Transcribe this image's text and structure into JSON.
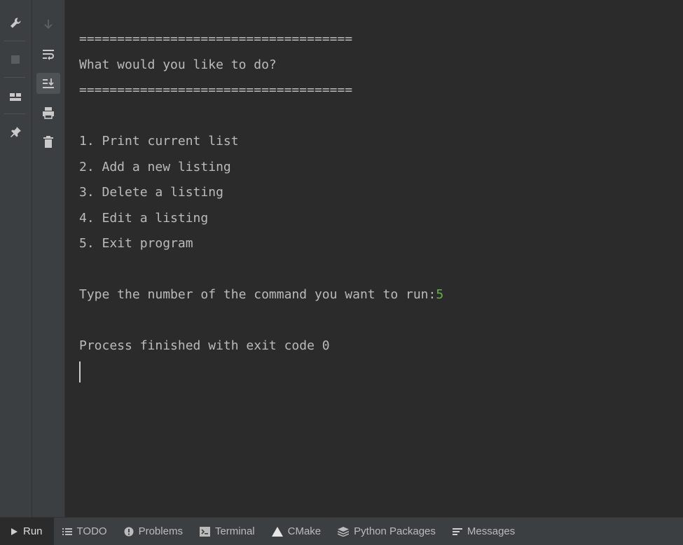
{
  "window": {
    "title": "Run"
  },
  "console": {
    "lines": [
      "====================================",
      "What would you like to do?",
      "====================================",
      "",
      "1. Print current list",
      "2. Add a new listing",
      "3. Delete a listing",
      "4. Edit a listing",
      "5. Exit program",
      "",
      "Type the number of the command you want to run:",
      "",
      "Process finished with exit code 0"
    ],
    "user_input": "5"
  },
  "left_toolbar": {
    "icons": [
      "wrench-icon",
      "stop-icon",
      "layout-icon",
      "pin-icon"
    ]
  },
  "console_toolbar": {
    "icons": [
      "scroll-down-icon",
      "soft-wrap-icon",
      "scroll-to-end-icon",
      "print-icon",
      "trash-icon"
    ],
    "active": "scroll-to-end-icon"
  },
  "bottom_tabs": [
    {
      "label": "Run",
      "icon": "play-icon",
      "active": true
    },
    {
      "label": "TODO",
      "icon": "list-icon",
      "active": false
    },
    {
      "label": "Problems",
      "icon": "alert-icon",
      "active": false
    },
    {
      "label": "Terminal",
      "icon": "terminal-icon",
      "active": false
    },
    {
      "label": "CMake",
      "icon": "cmake-icon",
      "active": false
    },
    {
      "label": "Python Packages",
      "icon": "packages-icon",
      "active": false
    },
    {
      "label": "Messages",
      "icon": "messages-icon",
      "active": false
    }
  ],
  "colors": {
    "background": "#2b2b2b",
    "toolbar": "#3c3f41",
    "text": "#bbbbbb",
    "user_input": "#62b543"
  }
}
